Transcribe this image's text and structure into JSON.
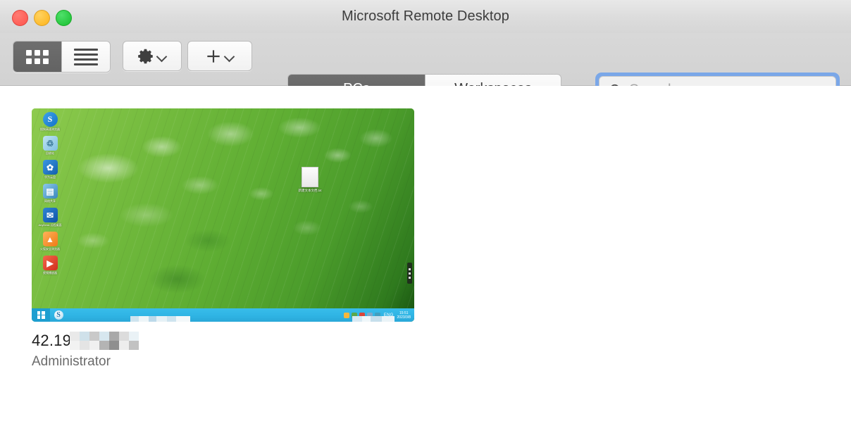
{
  "window": {
    "title": "Microsoft Remote Desktop",
    "controls": {
      "close_label": "",
      "minimize_label": "",
      "maximize_label": ""
    }
  },
  "toolbar": {
    "view_switch": {
      "grid_icon": "grid-view-icon",
      "list_icon": "list-view-icon",
      "active": "grid"
    },
    "settings_button": {
      "icon": "gear-icon",
      "chevron": "chevron-down-icon"
    },
    "add_button": {
      "icon": "plus-icon",
      "chevron": "chevron-down-icon"
    },
    "tabs": [
      {
        "label": "PCs",
        "active": true
      },
      {
        "label": "Workspaces",
        "active": false
      }
    ],
    "search": {
      "icon": "search-icon",
      "placeholder": "Search",
      "value": "",
      "focused": true,
      "focus_ring_color": "#7aa7e8"
    }
  },
  "content": {
    "pcs": [
      {
        "name_visible": "42.19",
        "name_redacted": true,
        "user": "Administrator",
        "thumbnail": {
          "wallpaper": "green-leaf-water-drops",
          "desktop_icons": [
            {
              "id": "sogou-browser-icon",
              "glyph": "S",
              "color": "#1f86d8",
              "caption": "搜狗高速浏览器"
            },
            {
              "id": "recycle-bin-icon",
              "glyph": "♲",
              "color": "#7fbfe0",
              "caption": "回收站"
            },
            {
              "id": "app-blue-icon",
              "glyph": "✿",
              "color": "#1f7fd0",
              "caption": "华为云盘"
            },
            {
              "id": "network-icon",
              "glyph": "▤",
              "color": "#4a9ad0",
              "caption": "网络共享"
            },
            {
              "id": "mail-icon",
              "glyph": "✉",
              "color": "#1c6fc4",
              "caption": "AnyDesk 远程桌面"
            },
            {
              "id": "flame-icon",
              "glyph": "▲",
              "color": "#f08a22",
              "caption": "火狐安全浏览器"
            },
            {
              "id": "media-icon",
              "glyph": "▶",
              "color": "#e0452b",
              "caption": "视频播放器"
            }
          ],
          "center_file": {
            "id": "text-document-icon",
            "caption": "新建文本文档.txt"
          },
          "taskbar": {
            "start_icon": "windows-start-icon",
            "pinned_app": "S",
            "tray_icons": [
              {
                "id": "tray-shield-icon",
                "color": "#f5b73d"
              },
              {
                "id": "tray-green-icon",
                "color": "#5aa84a"
              },
              {
                "id": "tray-red-icon",
                "color": "#d9453a"
              },
              {
                "id": "tray-blue-icon",
                "color": "#7fa8c8"
              },
              {
                "id": "tray-teal-icon",
                "color": "#3f9fc0"
              }
            ],
            "language": "ENG",
            "clock_time": "15:51",
            "clock_date": "2023/3/8"
          },
          "edge_toolbar": "floating-mini-toolbar"
        }
      }
    ]
  }
}
